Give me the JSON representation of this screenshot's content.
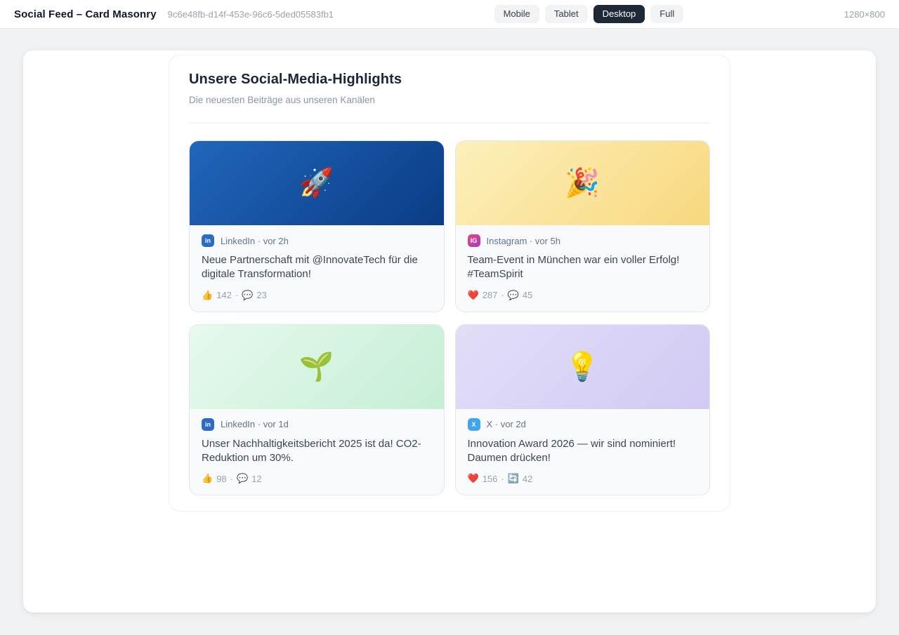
{
  "topbar": {
    "title": "Social Feed – Card Masonry",
    "uuid": "9c6e48fb-d14f-453e-96c6-5ded05583fb1",
    "devices": [
      {
        "label": "Mobile",
        "active": false
      },
      {
        "label": "Tablet",
        "active": false
      },
      {
        "label": "Desktop",
        "active": true
      },
      {
        "label": "Full",
        "active": false
      }
    ],
    "size_label": "1280×800",
    "colors": {
      "active_btn_bg": "#1e2836",
      "inactive_btn_bg": "#f2f3f5"
    }
  },
  "feed": {
    "title": "Unsere Social-Media-Highlights",
    "subtitle": "Die neuesten Beiträge aus unseren Kanälen",
    "stats_separator": "·",
    "cards": [
      {
        "platform": "LinkedIn",
        "badge": {
          "text": "in",
          "bg": "#2b6cc8"
        },
        "meta": "LinkedIn · vor 2h",
        "image": {
          "emoji": "🚀",
          "emoji_name": "rocket-emoji",
          "gradient": "linear-gradient(135deg, #2166bb, #0a3c85)"
        },
        "text": "Neue Partnerschaft mit @InnovateTech für die digitale Transformation!",
        "stat1": {
          "icon": "👍",
          "count": "142"
        },
        "stat2": {
          "icon": "💬",
          "count": "23"
        }
      },
      {
        "platform": "Instagram",
        "badge": {
          "text": "IG",
          "bg": "linear-gradient(135deg, #e8457e, #a93bc0)"
        },
        "meta": "Instagram · vor 5h",
        "image": {
          "emoji": "🎉",
          "emoji_name": "party-popper-emoji",
          "gradient": "linear-gradient(135deg, #fdf0bc, #f8d87e)"
        },
        "text": "Team-Event in München war ein voller Erfolg! #TeamSpirit",
        "stat1": {
          "icon": "❤️",
          "count": "287"
        },
        "stat2": {
          "icon": "💬",
          "count": "45"
        }
      },
      {
        "platform": "LinkedIn",
        "badge": {
          "text": "in",
          "bg": "#2b6cc8"
        },
        "meta": "LinkedIn · vor 1d",
        "image": {
          "emoji": "🌱",
          "emoji_name": "seedling-emoji",
          "gradient": "linear-gradient(135deg, #e7faee, #c6eed6)"
        },
        "text": "Unser Nachhaltigkeitsbericht 2025 ist da! CO2-Reduktion um 30%.",
        "stat1": {
          "icon": "👍",
          "count": "98"
        },
        "stat2": {
          "icon": "💬",
          "count": "12"
        }
      },
      {
        "platform": "X",
        "badge": {
          "text": "X",
          "bg": "#41a4f1"
        },
        "meta": "X · vor 2d",
        "image": {
          "emoji": "💡",
          "emoji_name": "light-bulb-emoji",
          "gradient": "linear-gradient(135deg, #e2def9, #d2caf3)"
        },
        "text": "Innovation Award 2026 — wir sind nominiert! Daumen drücken!",
        "stat1": {
          "icon": "❤️",
          "count": "156"
        },
        "stat2": {
          "icon": "🔄",
          "count": "42"
        }
      }
    ]
  }
}
